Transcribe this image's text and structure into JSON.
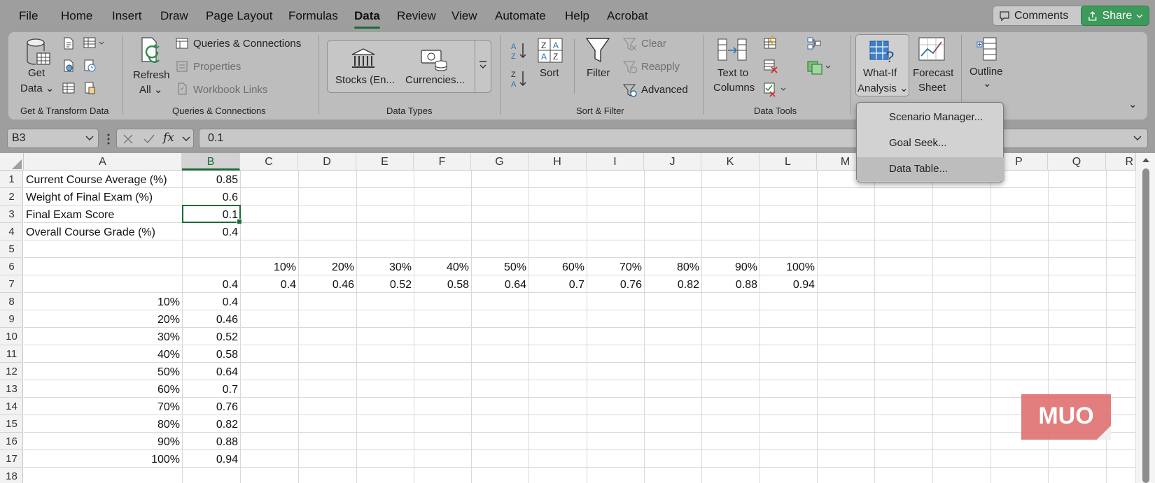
{
  "menu": {
    "tabs": [
      "File",
      "Home",
      "Insert",
      "Draw",
      "Page Layout",
      "Formulas",
      "Data",
      "Review",
      "View",
      "Automate",
      "Help",
      "Acrobat"
    ],
    "active": "Data",
    "comments_label": "Comments",
    "share_label": "Share"
  },
  "ribbon": {
    "get_transform": {
      "get_data_label1": "Get",
      "get_data_label2": "Data",
      "group_label": "Get & Transform Data"
    },
    "queries": {
      "refresh_label1": "Refresh",
      "refresh_label2": "All",
      "queries_connections": "Queries & Connections",
      "properties": "Properties",
      "workbook_links": "Workbook Links",
      "group_label": "Queries & Connections"
    },
    "data_types": {
      "stocks": "Stocks (En...",
      "currencies": "Currencies...",
      "group_label": "Data Types"
    },
    "sort_filter": {
      "sort": "Sort",
      "filter": "Filter",
      "clear": "Clear",
      "reapply": "Reapply",
      "advanced": "Advanced",
      "group_label": "Sort & Filter"
    },
    "data_tools": {
      "text_to_columns1": "Text to",
      "text_to_columns2": "Columns",
      "group_label": "Data Tools"
    },
    "forecast": {
      "what_if1": "What-If",
      "what_if2": "Analysis",
      "forecast1": "Forecast",
      "forecast2": "Sheet"
    },
    "outline": {
      "label": "Outline"
    }
  },
  "whatif_menu": {
    "items": [
      "Scenario Manager...",
      "Goal Seek...",
      "Data Table..."
    ],
    "highlighted": "Data Table..."
  },
  "formula_bar": {
    "name_box": "B3",
    "fx": "fx",
    "formula": "0.1"
  },
  "sheet": {
    "columns": [
      "A",
      "B",
      "C",
      "D",
      "E",
      "F",
      "G",
      "H",
      "I",
      "J",
      "K",
      "L",
      "M",
      "N",
      "O",
      "P",
      "Q",
      "R"
    ],
    "selected_column": "B",
    "rows": [
      "1",
      "2",
      "3",
      "4",
      "5",
      "6",
      "7",
      "8",
      "9",
      "10",
      "11",
      "12",
      "13",
      "14",
      "15",
      "16",
      "17",
      "18"
    ],
    "labels": {
      "a1": "Current Course Average (%)",
      "a2": "Weight of Final Exam (%)",
      "a3": "Final Exam Score",
      "a4": "Overall Course Grade (%)"
    },
    "values": {
      "b1": "0.85",
      "b2": "0.6",
      "b3": "0.1",
      "b4": "0.4",
      "b7": "0.4"
    },
    "row6_headers": [
      "10%",
      "20%",
      "30%",
      "40%",
      "50%",
      "60%",
      "70%",
      "80%",
      "90%",
      "100%"
    ],
    "row7_values": [
      "0.4",
      "0.46",
      "0.52",
      "0.58",
      "0.64",
      "0.7",
      "0.76",
      "0.82",
      "0.88",
      "0.94"
    ],
    "col_a_percents": [
      "10%",
      "20%",
      "30%",
      "40%",
      "50%",
      "60%",
      "70%",
      "80%",
      "90%",
      "100%"
    ],
    "col_b_values": [
      "0.4",
      "0.46",
      "0.52",
      "0.58",
      "0.64",
      "0.7",
      "0.76",
      "0.82",
      "0.88",
      "0.94"
    ]
  },
  "watermark": "MUO",
  "colors": {
    "accent": "#1e6b3a",
    "share": "#3c9a5b",
    "logo": "#e07070"
  }
}
